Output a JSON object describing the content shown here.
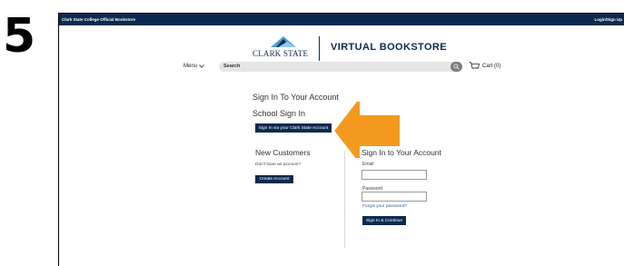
{
  "step": {
    "number": "5"
  },
  "topbar": {
    "store_name": "Clark State College Official Bookstore",
    "login_link": "Login/Sign Up"
  },
  "logo": {
    "text": "CLARK STATE",
    "title": "VIRTUAL BOOKSTORE"
  },
  "nav": {
    "menu_label": "Menu",
    "search_placeholder": "Search",
    "cart_label": "Cart (0)"
  },
  "signin": {
    "heading": "Sign In To Your Account",
    "school_heading": "School Sign In",
    "school_button": "Sign In via your Clark State Account"
  },
  "new_customers": {
    "heading": "New Customers",
    "no_account_text": "Don't have an account?",
    "create_button": "Create Account"
  },
  "account_signin": {
    "heading": "Sign In to Your Account",
    "email_label": "Email",
    "email_value": "",
    "password_label": "Password",
    "password_value": "",
    "forgot_link": "Forgot your password?",
    "signin_button": "Sign In & Continue"
  },
  "colors": {
    "navy": "#0c2a4f",
    "arrow_orange": "#f39a1e",
    "search_gray": "#7d7d7d"
  },
  "icons": [
    "chevron-down-icon",
    "search-icon",
    "cart-icon",
    "logo-mark-icon",
    "pointer-arrow-icon"
  ]
}
